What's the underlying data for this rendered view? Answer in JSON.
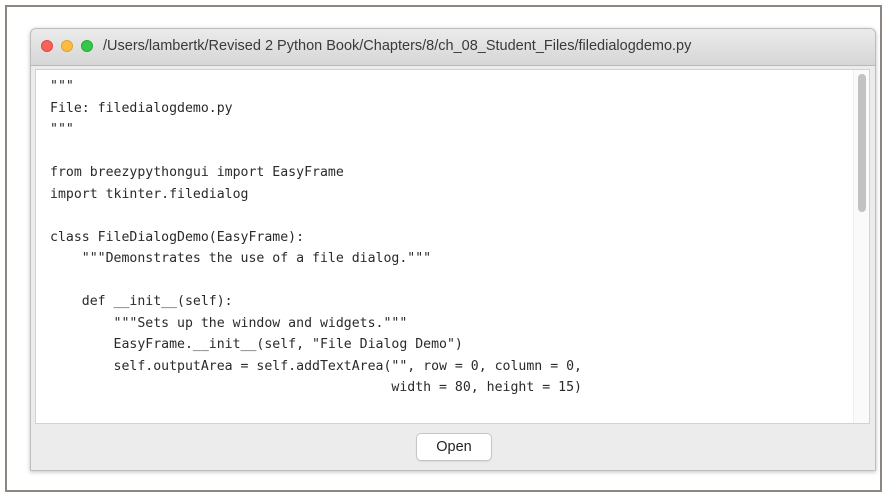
{
  "window": {
    "title": "/Users/lambertk/Revised 2 Python Book/Chapters/8/ch_08_Student_Files/filedialogdemo.py",
    "controls": {
      "close_color": "#fc605b",
      "minimize_color": "#fdbc40",
      "maximize_color": "#34c84a"
    }
  },
  "editor": {
    "lines": [
      "\"\"\"",
      "File: filedialogdemo.py",
      "\"\"\"",
      "",
      "from breezypythongui import EasyFrame",
      "import tkinter.filedialog",
      "",
      "class FileDialogDemo(EasyFrame):",
      "    \"\"\"Demonstrates the use of a file dialog.\"\"\"",
      "",
      "    def __init__(self):",
      "        \"\"\"Sets up the window and widgets.\"\"\"",
      "        EasyFrame.__init__(self, \"File Dialog Demo\")",
      "        self.outputArea = self.addTextArea(\"\", row = 0, column = 0,",
      "                                           width = 80, height = 15)"
    ]
  },
  "buttons": {
    "open_label": "Open"
  }
}
